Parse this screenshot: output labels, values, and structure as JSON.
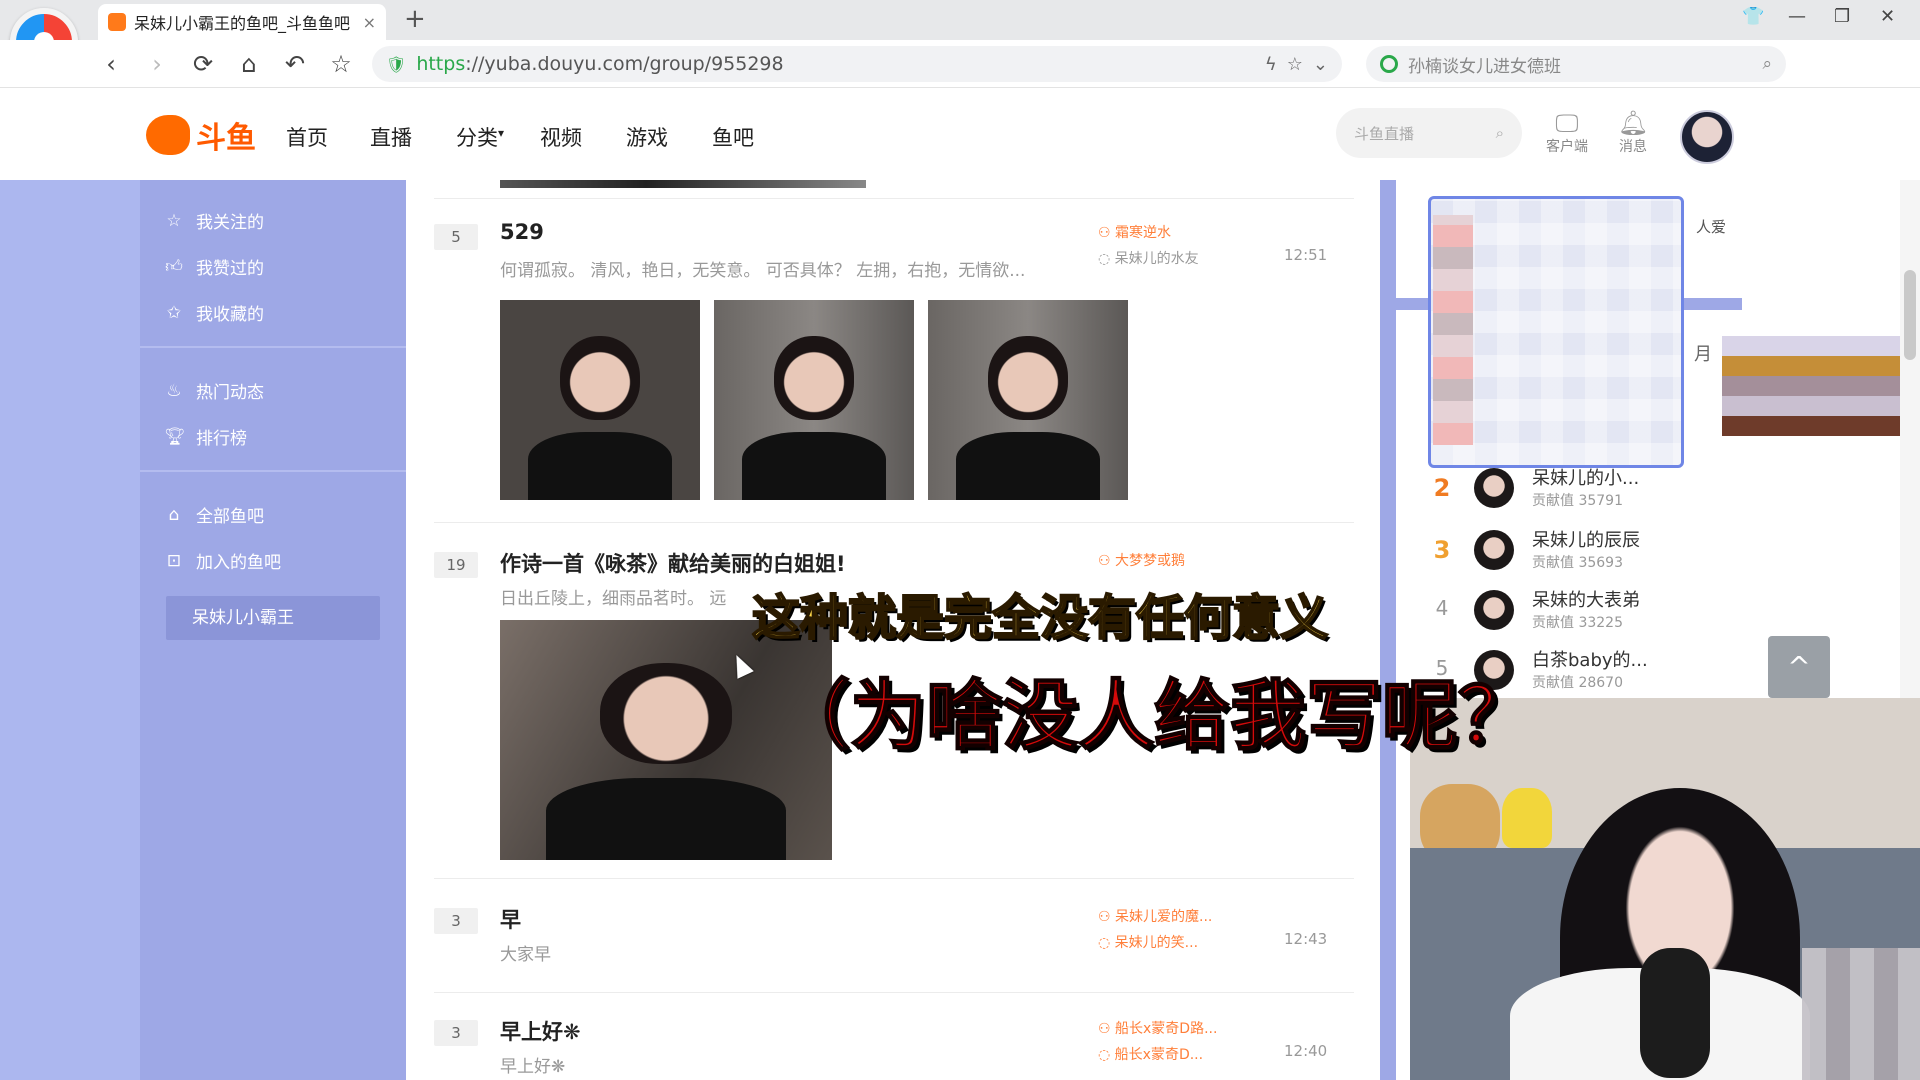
{
  "browser": {
    "tab_title": "呆妹儿小霸王的鱼吧_斗鱼鱼吧",
    "tab_close": "×",
    "new_tab": "+",
    "url_scheme": "https",
    "url_rest": "://yuba.douyu.com/group/955298",
    "search_text": "孙楠谈女儿进女德班"
  },
  "header": {
    "logo_text": "斗鱼",
    "nav": [
      "首页",
      "直播",
      "分类",
      "视频",
      "游戏",
      "鱼吧"
    ],
    "search_placeholder": "斗鱼直播",
    "client_label": "客户端",
    "message_label": "消息"
  },
  "sidebar": {
    "followed": "我关注的",
    "liked": "我赞过的",
    "favorited": "我收藏的",
    "hot": "热门动态",
    "ranking": "排行榜",
    "all_groups": "全部鱼吧",
    "joined_groups": "加入的鱼吧",
    "active_group": "呆妹儿小霸王"
  },
  "posts": [
    {
      "count": "5",
      "title": "529",
      "excerpt": "何谓孤寂。 清风，艳日，无笑意。 可否具体？ 左拥，右抱，无情欲...",
      "author": "霜寒逆水",
      "last_reply": "呆妹儿的水友",
      "time": "12:51"
    },
    {
      "count": "19",
      "title": "作诗一首《咏茶》献给美丽的白姐姐!",
      "excerpt": "日出丘陵上，细雨品茗时。 远",
      "author": "大梦梦或鹅",
      "last_reply": "",
      "time": ""
    },
    {
      "count": "3",
      "title": "早",
      "excerpt": "大家早",
      "author": "呆妹儿爱的魔...",
      "last_reply": "呆妹儿的笑...",
      "time": "12:43"
    },
    {
      "count": "3",
      "title": "早上好❋",
      "excerpt": "早上好❋",
      "author": "船长x蒙奇D路...",
      "last_reply": "船长x蒙奇D...",
      "time": "12:40"
    }
  ],
  "right_panel": {
    "fan_label": "人爱",
    "month_label": "月",
    "rank": [
      {
        "no": "2",
        "name": "呆妹儿的小...",
        "score": "贡献值 35791",
        "color": "#f07b22"
      },
      {
        "no": "3",
        "name": "呆妹儿的辰辰",
        "score": "贡献值 35693",
        "color": "#f0a030"
      },
      {
        "no": "4",
        "name": "呆妹的大表弟",
        "score": "贡献值 33225",
        "color": "#999999"
      },
      {
        "no": "5",
        "name": "白茶baby的...",
        "score": "贡献值 28670",
        "color": "#999999"
      }
    ],
    "to_top": "^"
  },
  "subtitles": {
    "line1": "这种就是完全没有任何意义",
    "line2": "（为啥没人给我写呢？"
  },
  "colors": {
    "sidebar": "#9ea8e6",
    "accent": "#ff5a00",
    "caption_yellow": "#ffd84a",
    "caption_red": "#d40a0a"
  }
}
